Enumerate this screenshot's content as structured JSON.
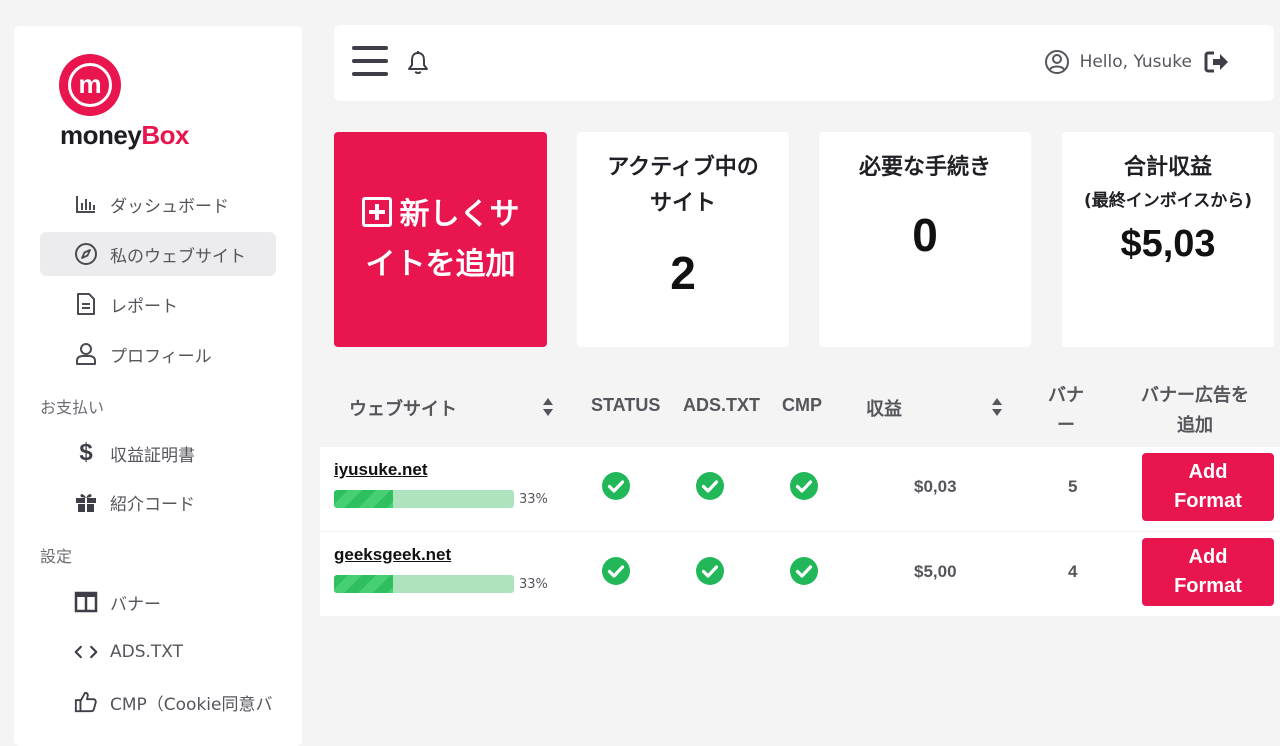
{
  "brand": {
    "name_part1": "money",
    "name_part2": "Box",
    "logo_letter": "m",
    "accent": "#e8154e"
  },
  "sidebar": {
    "items": [
      {
        "label": "ダッシュボード",
        "icon": "bar-chart-icon"
      },
      {
        "label": "私のウェブサイト",
        "icon": "compass-icon",
        "active": true
      },
      {
        "label": "レポート",
        "icon": "document-icon"
      },
      {
        "label": "プロフィール",
        "icon": "user-icon"
      }
    ],
    "section_payments": "お支払い",
    "payment_items": [
      {
        "label": "収益証明書",
        "icon": "dollar-icon"
      },
      {
        "label": "紹介コード",
        "icon": "gift-icon"
      }
    ],
    "section_settings": "設定",
    "settings_items": [
      {
        "label": "バナー",
        "icon": "columns-icon"
      },
      {
        "label": "ADS.TXT",
        "icon": "code-icon"
      },
      {
        "label": "CMP（Cookie同意バ",
        "icon": "thumbs-up-icon"
      }
    ]
  },
  "header": {
    "greeting": "Hello, Yusuke"
  },
  "add_site": {
    "line1": "新しくサ",
    "line2": "イトを追加"
  },
  "stats": [
    {
      "title_line1": "アクティブ中の",
      "title_line2": "サイト",
      "value": "2"
    },
    {
      "title_line1": "必要な手続き",
      "value": "0"
    },
    {
      "title_line1": "合計収益",
      "subtitle": "(最終インボイスから)",
      "value": "$5,03"
    }
  ],
  "table": {
    "headers": {
      "website": "ウェブサイト",
      "status": "STATUS",
      "ads_txt": "ADS.TXT",
      "cmp": "CMP",
      "revenue": "収益",
      "banner_line1": "バナ",
      "banner_line2": "ー",
      "add_banner_line1": "バナー広告を",
      "add_banner_line2": "追加"
    },
    "rows": [
      {
        "site": "iyusuke.net",
        "progress_pct": 33,
        "progress_label": "33%",
        "status_ok": true,
        "ads_txt_ok": true,
        "cmp_ok": true,
        "revenue": "$0,03",
        "banners": "5",
        "button_line1": "Add",
        "button_line2": "Format"
      },
      {
        "site": "geeksgeek.net",
        "progress_pct": 33,
        "progress_label": "33%",
        "status_ok": true,
        "ads_txt_ok": true,
        "cmp_ok": true,
        "revenue": "$5,00",
        "banners": "4",
        "button_line1": "Add",
        "button_line2": "Format"
      }
    ]
  },
  "colors": {
    "accent": "#e8154e",
    "success": "#22b85a",
    "progress_bg": "#aee3c0"
  }
}
